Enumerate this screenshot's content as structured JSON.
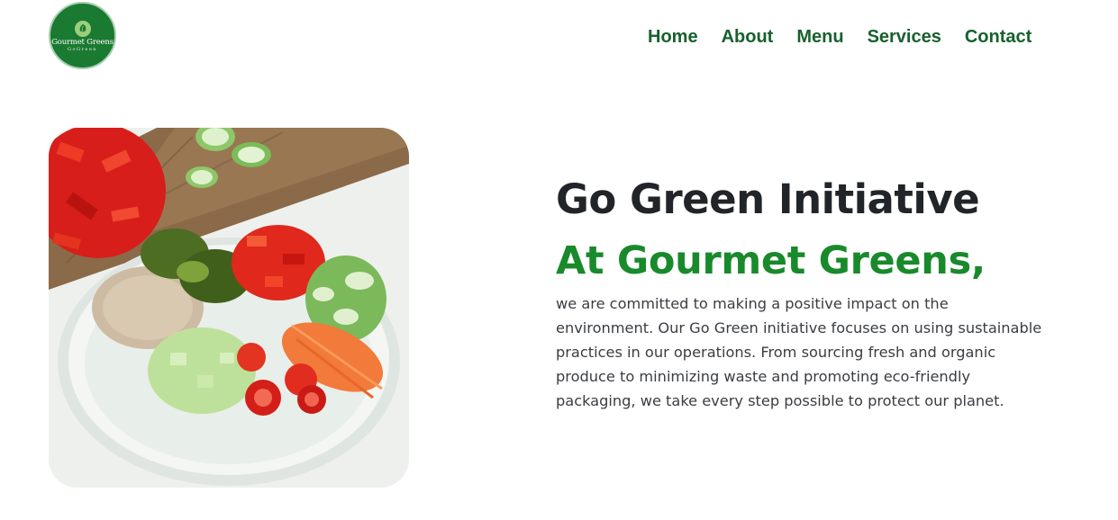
{
  "header": {
    "logo": {
      "name": "Gourmet Greens",
      "tagline": "GoGreen",
      "icon": "leaf-icon",
      "bg_color": "#1a7a32"
    },
    "nav": [
      {
        "label": "Home"
      },
      {
        "label": "About"
      },
      {
        "label": "Menu"
      },
      {
        "label": "Services"
      },
      {
        "label": "Contact"
      }
    ],
    "nav_color": "#17612c"
  },
  "hero": {
    "image": "vegetable-bowl-photo",
    "title": "Go Green Initiative",
    "subtitle": "At Gourmet Greens,",
    "subtitle_color": "#188a2b",
    "body": "we are committed to making a positive impact on the environment. Our Go Green initiative focuses on using sustainable practices in our operations. From sourcing fresh and organic produce to minimizing waste and promoting eco-friendly packaging, we take every step possible to protect our planet."
  }
}
